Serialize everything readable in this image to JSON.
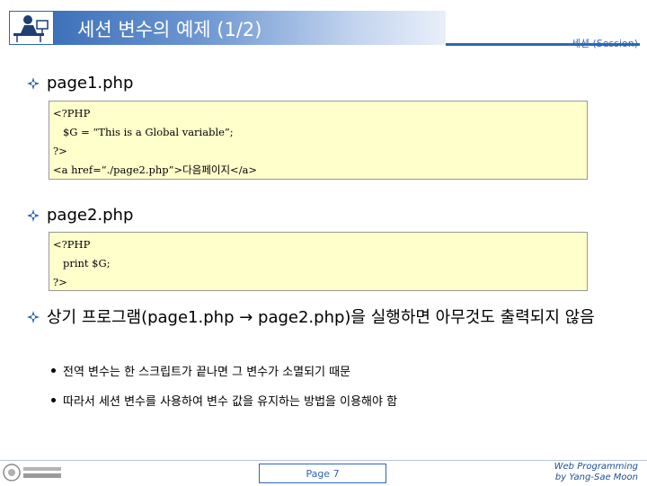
{
  "header": {
    "title": "세션 변수의 예제 (1/2)",
    "section": "세션 (Session)"
  },
  "icons": [
    "person-at-desk-icon",
    "bullet-icon",
    "college-logo-icon"
  ],
  "colors": {
    "accent": "#2f66b3",
    "code_bg": "#ffffcc"
  },
  "sections": [
    {
      "heading": "page1.php",
      "code": [
        "<?PHP",
        "   $G = “This is a Global variable”;",
        "?>",
        "<a href=“./page2.php”>다음페이지</a>"
      ]
    },
    {
      "heading": "page2.php",
      "code": [
        "<?PHP",
        "   print $G;",
        "?>"
      ]
    }
  ],
  "explanation": {
    "text": "상기 프로그램(page1.php → page2.php)을 실행하면 아무것도 출력되지 않음",
    "sub_items": [
      "전역 변수는 한 스크립트가 끝나면 그 변수가 소멸되기 때문",
      "따라서 세션 변수를 사용하여 변수 값을 유지하는 방법을 이용해야 함"
    ]
  },
  "footer": {
    "page": "Page 7",
    "credit_line1": "Web Programming",
    "credit_line2": "by Yang-Sae Moon"
  }
}
